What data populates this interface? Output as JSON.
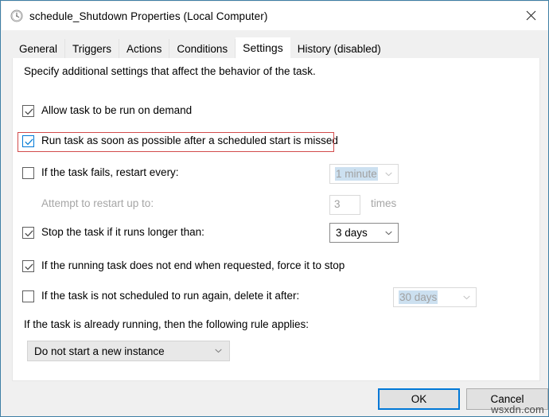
{
  "window": {
    "title": "schedule_Shutdown Properties (Local Computer)",
    "icon": "clock-icon",
    "close_label": "×",
    "accent_color": "#0078d7",
    "highlight_color": "#d24c4c"
  },
  "tabs": [
    {
      "label": "General",
      "active": false
    },
    {
      "label": "Triggers",
      "active": false
    },
    {
      "label": "Actions",
      "active": false
    },
    {
      "label": "Conditions",
      "active": false
    },
    {
      "label": "Settings",
      "active": true
    },
    {
      "label": "History (disabled)",
      "active": false
    }
  ],
  "content": {
    "intro": "Specify additional settings that affect the behavior of the task.",
    "rows": [
      {
        "id": "allow-on-demand",
        "label": "Allow task to be run on demand",
        "checked": true,
        "enabled": true,
        "highlighted": false
      },
      {
        "id": "run-asap-after-missed",
        "label": "Run task as soon as possible after a scheduled start is missed",
        "checked": true,
        "enabled": true,
        "highlighted": true
      },
      {
        "id": "restart-on-failure",
        "label": "If the task fails, restart every:",
        "checked": false,
        "enabled": true,
        "highlighted": false
      },
      {
        "id": "attempt-restart-up-to",
        "label": "Attempt to restart up to:",
        "checked": null,
        "enabled": false,
        "highlighted": false
      },
      {
        "id": "stop-if-runs-longer",
        "label": "Stop the task if it runs longer than:",
        "checked": true,
        "enabled": true,
        "highlighted": false
      },
      {
        "id": "force-stop",
        "label": "If the running task does not end when requested, force it to stop",
        "checked": true,
        "enabled": true,
        "highlighted": false
      },
      {
        "id": "delete-if-not-scheduled",
        "label": "If the task is not scheduled to run again, delete it after:",
        "checked": false,
        "enabled": true,
        "highlighted": false
      }
    ],
    "restart_interval": {
      "value": "1 minute",
      "enabled": false
    },
    "restart_count": {
      "value": "3",
      "enabled": false,
      "suffix": "times"
    },
    "stop_after": {
      "value": "3 days",
      "enabled": true
    },
    "delete_after": {
      "value": "30 days",
      "enabled": false
    },
    "rule_label": "If the task is already running, then the following rule applies:",
    "rule_value": "Do not start a new instance"
  },
  "footer": {
    "ok_label": "OK",
    "cancel_label": "Cancel"
  },
  "watermark": "wsxdn.com"
}
